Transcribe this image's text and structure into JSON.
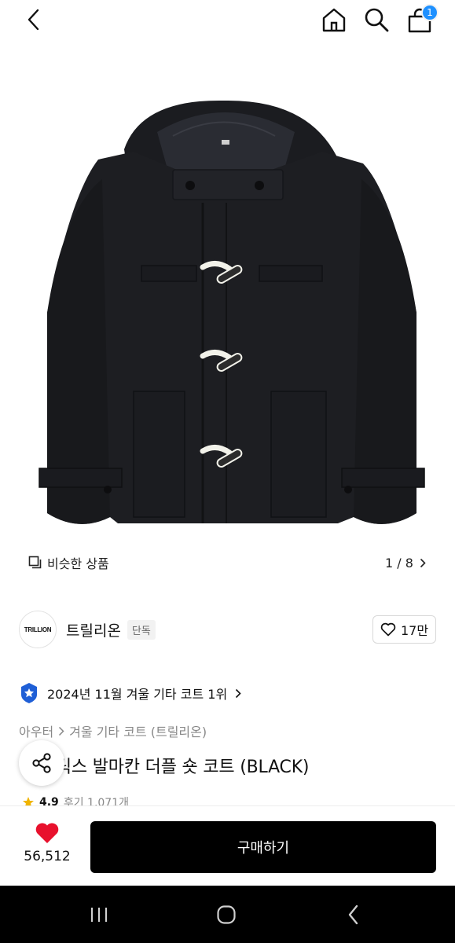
{
  "topbar": {
    "cart_badge": "1"
  },
  "gallery": {
    "similar_label": "비슷한 상품",
    "pager": "1 / 8"
  },
  "brand": {
    "logo_text": "TRILLION",
    "name": "트릴리온",
    "tag": "단독",
    "likes": "17만"
  },
  "ranking": {
    "text": "2024년 11월 겨울 기타 코트 1위"
  },
  "breadcrumb": {
    "parent": "아우터",
    "child": "겨울 기타 코트 (트릴리온)"
  },
  "product": {
    "title": "멜톤 릭스 발마칸 더플 숏 코트 (BLACK)",
    "rating": "4.9",
    "review_text": "후기 1,071개"
  },
  "bottom": {
    "wish_count": "56,512",
    "buy_label": "구매하기"
  },
  "colors": {
    "accent_blue": "#1e90ff",
    "heart_red": "#e8112d",
    "buy_black": "#000000"
  }
}
